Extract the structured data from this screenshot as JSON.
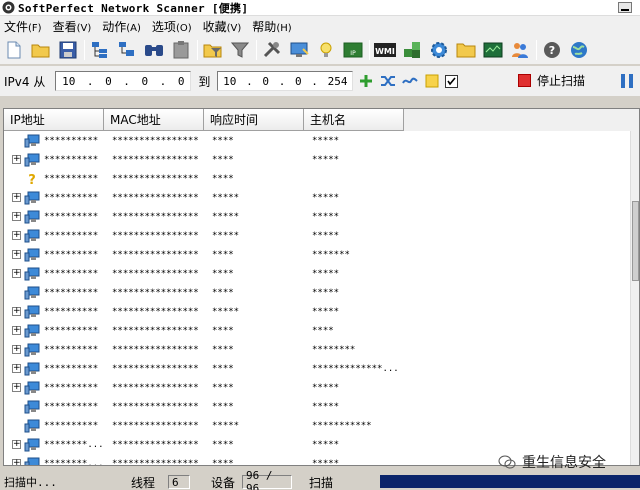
{
  "window": {
    "title": "SoftPerfect Network Scanner [便携]"
  },
  "menu": [
    {
      "label": "文件",
      "key": "(F)"
    },
    {
      "label": "查看",
      "key": "(V)"
    },
    {
      "label": "动作",
      "key": "(A)"
    },
    {
      "label": "选项",
      "key": "(O)"
    },
    {
      "label": "收藏",
      "key": "(V)"
    },
    {
      "label": "帮助",
      "key": "(H)"
    }
  ],
  "toolbar_icons": [
    "new-icon",
    "open-folder-icon",
    "save-icon",
    "expand-tree-icon",
    "collapse-tree-icon",
    "find-icon",
    "clipboard-icon",
    "filter-icon",
    "funnel-icon",
    "tools-icon",
    "remote-computer-icon",
    "lightbulb-icon",
    "ip-card-icon",
    "wmi-icon",
    "registry-icon",
    "settings-gear-icon",
    "folder-icon",
    "monitor-graph-icon",
    "users-icon",
    "help-icon",
    "globe-icon"
  ],
  "range": {
    "label": "IPv4 从",
    "from_ip": [
      "10",
      "0",
      "0",
      "0"
    ],
    "to_label": "到",
    "to_ip": [
      "10",
      "0",
      "0",
      "254"
    ],
    "stop_label": "停止扫描"
  },
  "table": {
    "columns": [
      "IP地址",
      "MAC地址",
      "响应时间",
      "主机名"
    ],
    "rows": [
      {
        "exp": "",
        "icon": "pc",
        "ip": "**********",
        "mac": "****************",
        "time": "****",
        "host": "*****"
      },
      {
        "exp": "+",
        "icon": "pc",
        "ip": "**********",
        "mac": "****************...",
        "time": "****",
        "host": "*****"
      },
      {
        "exp": "",
        "icon": "unknown",
        "ip": "**********",
        "mac": "****************...",
        "time": "****",
        "host": ""
      },
      {
        "exp": "+",
        "icon": "pc",
        "ip": "**********",
        "mac": "****************...",
        "time": "*****",
        "host": "*****"
      },
      {
        "exp": "+",
        "icon": "pc",
        "ip": "**********",
        "mac": "****************...",
        "time": "*****",
        "host": "*****"
      },
      {
        "exp": "+",
        "icon": "pc",
        "ip": "**********",
        "mac": "****************...",
        "time": "*****",
        "host": "*****"
      },
      {
        "exp": "+",
        "icon": "pc",
        "ip": "**********",
        "mac": "****************",
        "time": "****",
        "host": "*******"
      },
      {
        "exp": "+",
        "icon": "pc",
        "ip": "**********",
        "mac": "****************...",
        "time": "****",
        "host": "*****"
      },
      {
        "exp": "",
        "icon": "pc",
        "ip": "**********",
        "mac": "****************",
        "time": "****",
        "host": "*****"
      },
      {
        "exp": "+",
        "icon": "pc",
        "ip": "**********",
        "mac": "****************",
        "time": "*****",
        "host": "*****"
      },
      {
        "exp": "+",
        "icon": "pc",
        "ip": "**********",
        "mac": "****************...",
        "time": "****",
        "host": "****"
      },
      {
        "exp": "+",
        "icon": "pc",
        "ip": "**********",
        "mac": "****************",
        "time": "****",
        "host": "********"
      },
      {
        "exp": "+",
        "icon": "pc",
        "ip": "**********",
        "mac": "****************",
        "time": "****",
        "host": "*************..."
      },
      {
        "exp": "+",
        "icon": "pc",
        "ip": "**********",
        "mac": "****************",
        "time": "****",
        "host": "*****"
      },
      {
        "exp": "",
        "icon": "pc",
        "ip": "**********",
        "mac": "****************",
        "time": "****",
        "host": "*****"
      },
      {
        "exp": "",
        "icon": "pc",
        "ip": "**********",
        "mac": "****************",
        "time": "*****",
        "host": "***********"
      },
      {
        "exp": "+",
        "icon": "pc",
        "ip": "********...",
        "mac": "****************",
        "time": "****",
        "host": "*****"
      },
      {
        "exp": "+",
        "icon": "pc",
        "ip": "********...",
        "mac": "****************",
        "time": "****",
        "host": "*****"
      }
    ]
  },
  "status": {
    "scanning": "扫描中...",
    "threads_label": "线程",
    "threads": "6",
    "devices_label": "设备",
    "devices": "96 / 96",
    "scan_label": "扫描",
    "progress": 1.0
  },
  "watermark": "重生信息安全",
  "colors": {
    "progress": "#0a246a",
    "stop": "#e03030",
    "toolbar_bg": "#f0f0f0"
  }
}
